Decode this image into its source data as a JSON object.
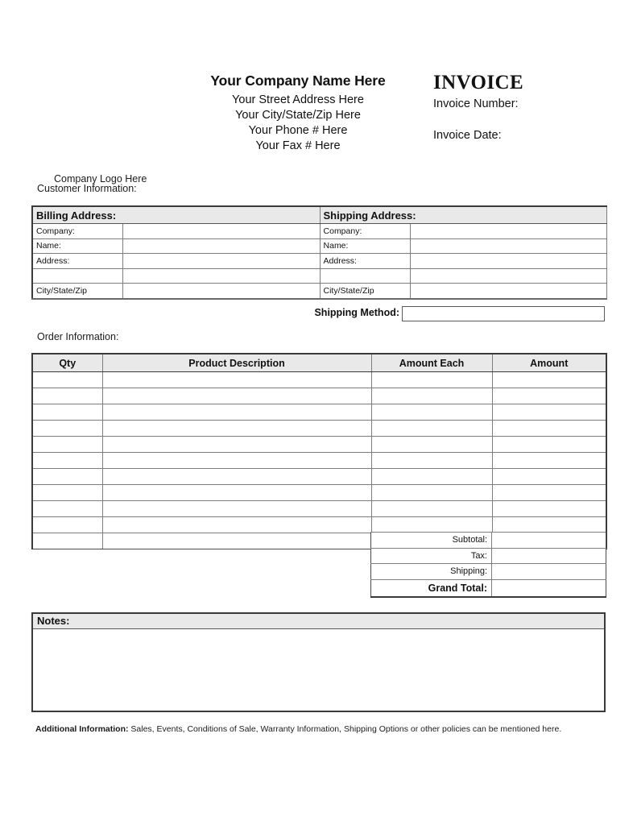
{
  "document": {
    "type": "invoice-template",
    "page_background": "#ffffff",
    "header_shade_color": "#e9e9e9",
    "border_color": "#3a3a3a"
  },
  "header": {
    "logo_placeholder": "Company Logo Here",
    "company_name": "Your Company Name Here",
    "company_lines": [
      "Your Street Address Here",
      "Your City/State/Zip Here",
      "Your Phone # Here",
      "Your Fax # Here"
    ],
    "invoice_title": "INVOICE",
    "invoice_number_label": "Invoice Number:",
    "invoice_number_value": "",
    "invoice_date_label": "Invoice Date:",
    "invoice_date_value": ""
  },
  "customer_section": {
    "label": "Customer Information:",
    "billing": {
      "header": "Billing Address:",
      "rows": [
        {
          "label": "Company:",
          "value": ""
        },
        {
          "label": "Name:",
          "value": ""
        },
        {
          "label": "Address:",
          "value": ""
        },
        {
          "label": "",
          "value": ""
        },
        {
          "label": "City/State/Zip",
          "value": ""
        }
      ]
    },
    "shipping": {
      "header": "Shipping Address:",
      "rows": [
        {
          "label": "Company:",
          "value": ""
        },
        {
          "label": "Name:",
          "value": ""
        },
        {
          "label": "Address:",
          "value": ""
        },
        {
          "label": "",
          "value": ""
        },
        {
          "label": "City/State/Zip",
          "value": ""
        }
      ]
    }
  },
  "shipping_method": {
    "label": "Shipping Method:",
    "value": "",
    "placeholder": ""
  },
  "order_section": {
    "label": "Order Information:",
    "columns": [
      "Qty",
      "Product Description",
      "Amount Each",
      "Amount"
    ],
    "rows": [
      {
        "qty": "",
        "description": "",
        "amount_each": "",
        "amount": ""
      },
      {
        "qty": "",
        "description": "",
        "amount_each": "",
        "amount": ""
      },
      {
        "qty": "",
        "description": "",
        "amount_each": "",
        "amount": ""
      },
      {
        "qty": "",
        "description": "",
        "amount_each": "",
        "amount": ""
      },
      {
        "qty": "",
        "description": "",
        "amount_each": "",
        "amount": ""
      },
      {
        "qty": "",
        "description": "",
        "amount_each": "",
        "amount": ""
      },
      {
        "qty": "",
        "description": "",
        "amount_each": "",
        "amount": ""
      },
      {
        "qty": "",
        "description": "",
        "amount_each": "",
        "amount": ""
      },
      {
        "qty": "",
        "description": "",
        "amount_each": "",
        "amount": ""
      },
      {
        "qty": "",
        "description": "",
        "amount_each": "",
        "amount": ""
      },
      {
        "qty": "",
        "description": "",
        "amount_each": "",
        "amount": ""
      }
    ],
    "totals": [
      {
        "label": "Subtotal:",
        "value": "",
        "emphasis": false
      },
      {
        "label": "Tax:",
        "value": "",
        "emphasis": false
      },
      {
        "label": "Shipping:",
        "value": "",
        "emphasis": false
      },
      {
        "label": "Grand Total:",
        "value": "",
        "emphasis": true
      }
    ]
  },
  "notes": {
    "header": "Notes:",
    "value": ""
  },
  "footer": {
    "label": "Additional Information:",
    "text": " Sales, Events, Conditions of Sale, Warranty Information, Shipping Options or other policies can be mentioned here."
  }
}
